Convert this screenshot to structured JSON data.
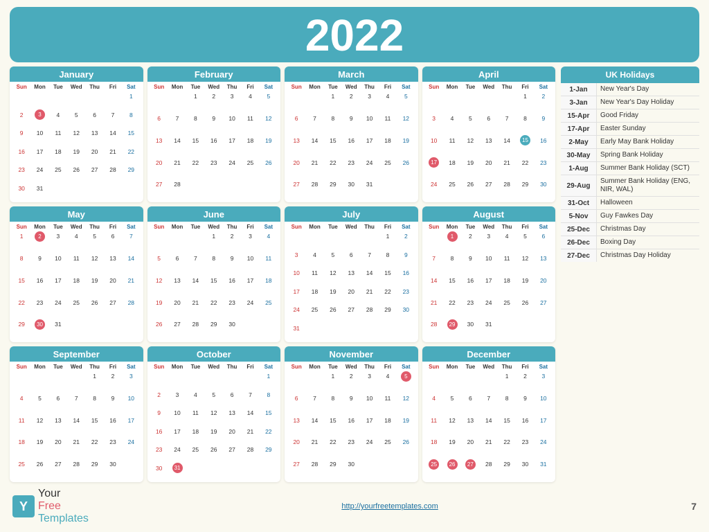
{
  "year": "2022",
  "months": [
    {
      "name": "January",
      "startDay": 6,
      "days": 31,
      "highlights": {
        "3": "red"
      },
      "row": 0
    },
    {
      "name": "February",
      "startDay": 2,
      "days": 28,
      "highlights": {},
      "row": 0
    },
    {
      "name": "March",
      "startDay": 2,
      "days": 31,
      "highlights": {},
      "row": 0
    },
    {
      "name": "April",
      "startDay": 5,
      "days": 30,
      "highlights": {
        "15": "blue",
        "17": "red"
      },
      "row": 0
    },
    {
      "name": "May",
      "startDay": 0,
      "days": 31,
      "highlights": {
        "2": "red",
        "30": "red"
      },
      "row": 1
    },
    {
      "name": "June",
      "startDay": 3,
      "days": 30,
      "highlights": {},
      "row": 1
    },
    {
      "name": "July",
      "startDay": 5,
      "days": 31,
      "highlights": {},
      "row": 1
    },
    {
      "name": "August",
      "startDay": 1,
      "days": 31,
      "highlights": {
        "1": "red",
        "29": "red"
      },
      "row": 1
    },
    {
      "name": "September",
      "startDay": 4,
      "days": 30,
      "highlights": {},
      "row": 2
    },
    {
      "name": "October",
      "startDay": 6,
      "days": 31,
      "highlights": {
        "31": "red"
      },
      "row": 2
    },
    {
      "name": "November",
      "startDay": 2,
      "days": 30,
      "highlights": {
        "5": "red"
      },
      "row": 2
    },
    {
      "name": "December",
      "startDay": 4,
      "days": 31,
      "highlights": {
        "25": "red",
        "26": "red",
        "27": "red"
      },
      "row": 2
    }
  ],
  "holidays": [
    {
      "date": "1-Jan",
      "name": "New Year's Day"
    },
    {
      "date": "3-Jan",
      "name": "New Year's Day Holiday"
    },
    {
      "date": "15-Apr",
      "name": "Good Friday"
    },
    {
      "date": "17-Apr",
      "name": "Easter Sunday"
    },
    {
      "date": "2-May",
      "name": "Early May Bank Holiday"
    },
    {
      "date": "30-May",
      "name": "Spring Bank Holiday"
    },
    {
      "date": "1-Aug",
      "name": "Summer Bank Holiday (SCT)"
    },
    {
      "date": "29-Aug",
      "name": "Summer Bank Holiday (ENG, NIR, WAL)"
    },
    {
      "date": "31-Oct",
      "name": "Halloween"
    },
    {
      "date": "5-Nov",
      "name": "Guy Fawkes Day"
    },
    {
      "date": "25-Dec",
      "name": "Christmas Day"
    },
    {
      "date": "26-Dec",
      "name": "Boxing Day"
    },
    {
      "date": "27-Dec",
      "name": "Christmas Day Holiday"
    }
  ],
  "footer": {
    "url": "http://yourfreetemplates.com",
    "page": "7",
    "logo_your": "Your",
    "logo_free": "Free",
    "logo_templates": "Templates"
  },
  "holidays_header": "UK Holidays"
}
